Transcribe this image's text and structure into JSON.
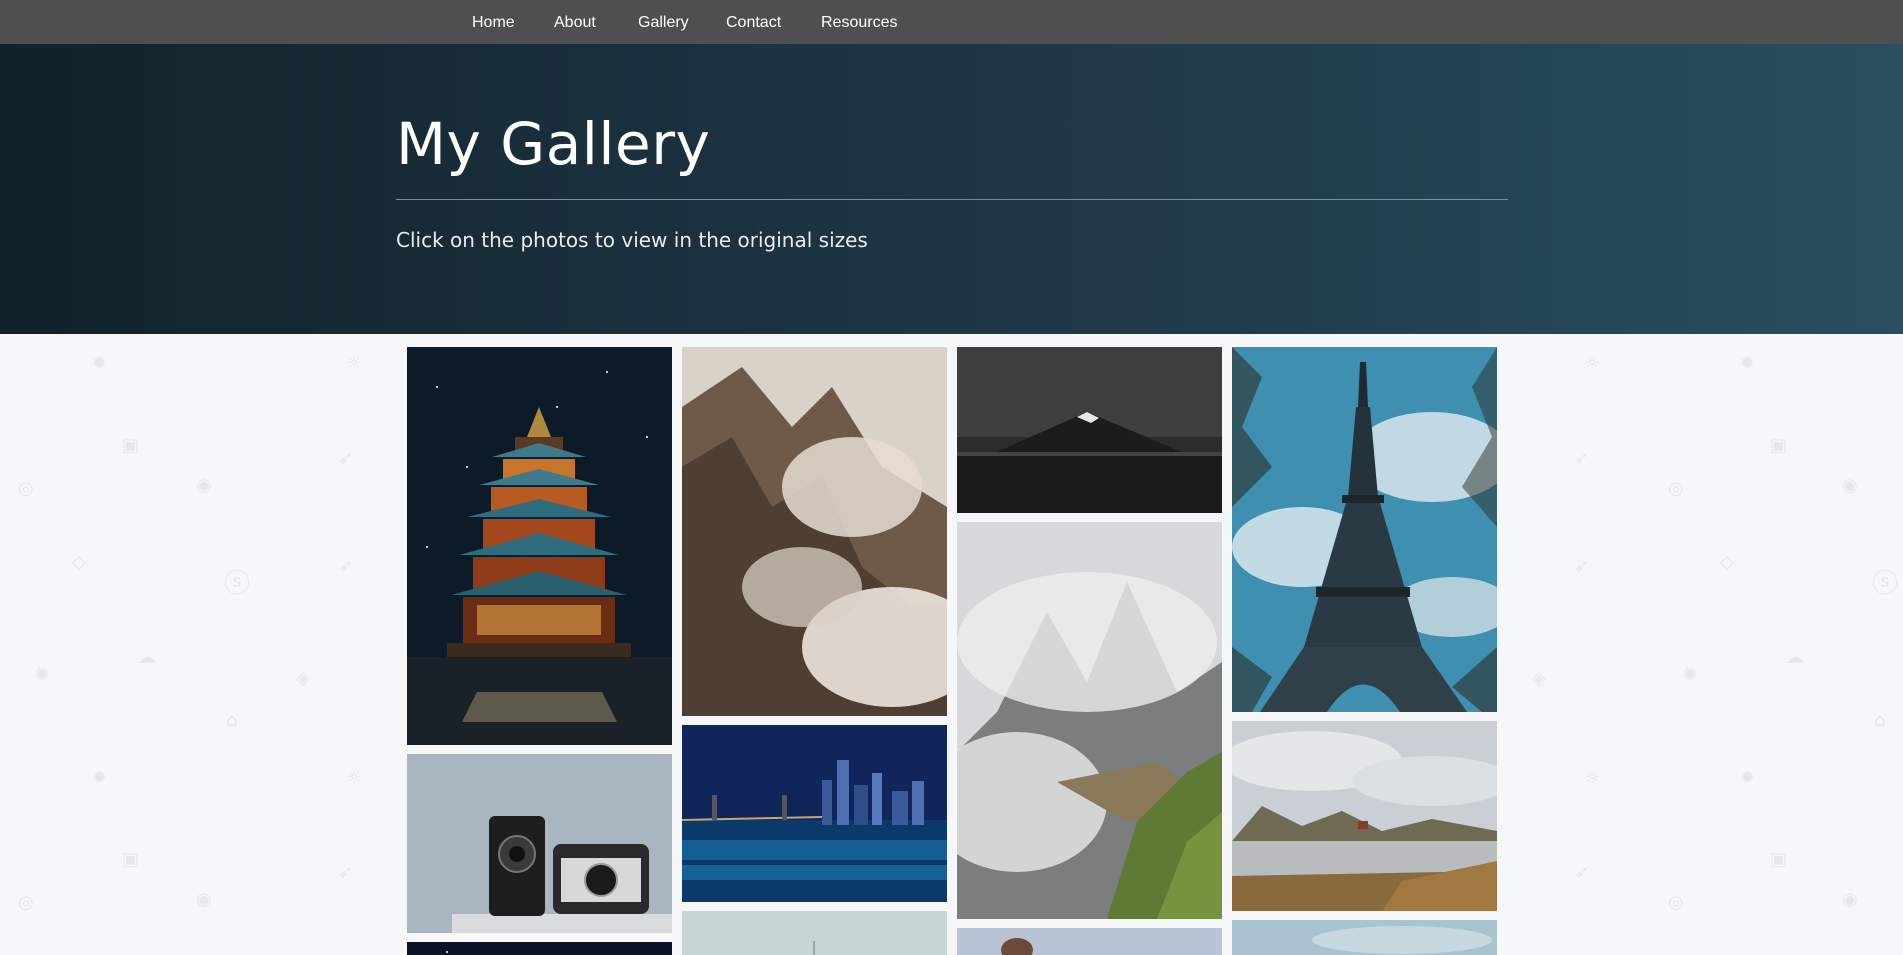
{
  "nav": {
    "items": [
      {
        "label": "Home"
      },
      {
        "label": "About"
      },
      {
        "label": "Gallery"
      },
      {
        "label": "Contact"
      },
      {
        "label": "Resources"
      }
    ]
  },
  "hero": {
    "title": "My Gallery",
    "subtitle": "Click on the photos to view in the original sizes"
  },
  "gallery": {
    "photos": [
      {
        "subject": "pagoda-at-night"
      },
      {
        "subject": "camera-still-life"
      },
      {
        "subject": "starry-sky"
      },
      {
        "subject": "misty-mountain-cliff"
      },
      {
        "subject": "city-skyline-bridge-night"
      },
      {
        "subject": "pale-sky"
      },
      {
        "subject": "volcano-reflection-monochrome"
      },
      {
        "subject": "machu-picchu-clouds"
      },
      {
        "subject": "person-partial"
      },
      {
        "subject": "eiffel-tower"
      },
      {
        "subject": "mountain-lake-cabin"
      },
      {
        "subject": "sky-partial"
      }
    ]
  },
  "colors": {
    "nav_bg": "#4f4f4f",
    "hero_gradient_start": "#11212a",
    "hero_gradient_end": "#294f60",
    "page_bg": "#f6f7f8"
  }
}
